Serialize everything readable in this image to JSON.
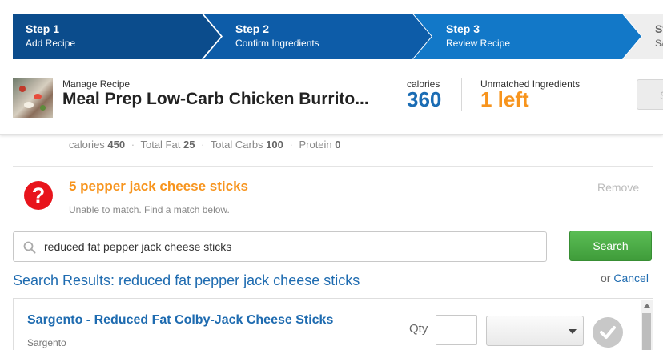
{
  "steps": [
    {
      "number": "Step 1",
      "label": "Add Recipe"
    },
    {
      "number": "Step 2",
      "label": "Confirm Ingredients"
    },
    {
      "number": "Step 3",
      "label": "Review Recipe"
    },
    {
      "number": "St",
      "label": "Sa"
    }
  ],
  "recipe": {
    "manage_label": "Manage Recipe",
    "title": "Meal Prep Low-Carb Chicken Burrito...",
    "calories_label": "calories",
    "calories_value": "360",
    "unmatched_label": "Unmatched Ingredients",
    "unmatched_value": "1 left",
    "save_label": "S"
  },
  "nutrition": {
    "calories_label": "calories",
    "calories_value": "450",
    "fat_label": "Total Fat",
    "fat_value": "25",
    "carbs_label": "Total Carbs",
    "carbs_value": "100",
    "protein_label": "Protein",
    "protein_value": "0"
  },
  "ingredient": {
    "name": "5 pepper jack cheese sticks",
    "note": "Unable to match. Find a match below.",
    "remove_label": "Remove",
    "alert_glyph": "?"
  },
  "search": {
    "value": "reduced fat pepper jack cheese sticks",
    "button_label": "Search"
  },
  "results": {
    "title": "Search Results: reduced fat pepper jack cheese sticks",
    "or_label": "or",
    "cancel_label": "Cancel",
    "items": [
      {
        "name": "Sargento - Reduced Fat Colby-Jack Cheese Sticks",
        "brand": "Sargento",
        "qty_label": "Qty",
        "qty_value": "",
        "unit_value": ""
      }
    ]
  },
  "colors": {
    "step_dark": "#0b4c8c",
    "step_mid": "#0d5ca8",
    "step_active": "#1278c8",
    "accent_blue": "#1e6bb0",
    "accent_orange": "#f7941d",
    "alert_red": "#e8141c",
    "search_green": "#4cae47"
  },
  "icons": {
    "search": "search-icon",
    "alert": "question-circle-icon",
    "dropdown": "chevron-down-icon",
    "check": "check-icon"
  }
}
